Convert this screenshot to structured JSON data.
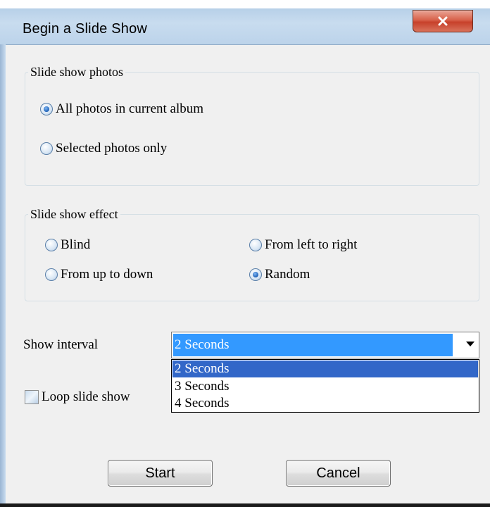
{
  "window": {
    "title": "Begin a Slide Show"
  },
  "photos_group": {
    "legend": "Slide show photos",
    "options": [
      {
        "label": "All photos in current album",
        "checked": true
      },
      {
        "label": "Selected photos only",
        "checked": false
      }
    ]
  },
  "effect_group": {
    "legend": "Slide show effect",
    "options": [
      {
        "label": "Blind",
        "checked": false
      },
      {
        "label": "From left to right",
        "checked": false
      },
      {
        "label": "From up to down",
        "checked": false
      },
      {
        "label": "Random",
        "checked": true
      }
    ]
  },
  "interval": {
    "label": "Show interval",
    "selected": "2 Seconds",
    "options": [
      "2 Seconds",
      "3 Seconds",
      "4 Seconds"
    ]
  },
  "loop": {
    "label": "Loop slide show",
    "checked": false
  },
  "buttons": {
    "start": "Start",
    "cancel": "Cancel"
  },
  "icons": {
    "close": "close-icon",
    "dropdown": "chevron-down-icon"
  },
  "colors": {
    "selection": "#3399ff",
    "list_highlight": "#3267c8",
    "close_button": "#c7402a"
  }
}
